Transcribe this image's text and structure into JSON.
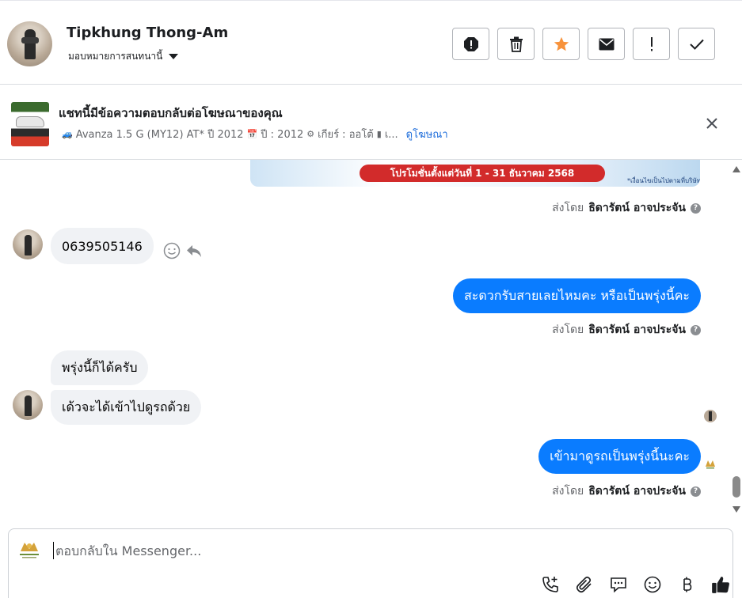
{
  "header": {
    "contact_name": "Tipkhung Thong-Am",
    "assign_label": "มอบหมายการสนทนานี้",
    "actions": [
      {
        "name": "spam-button",
        "icon": "octagon-alert-icon"
      },
      {
        "name": "delete-button",
        "icon": "trash-icon"
      },
      {
        "name": "star-button",
        "icon": "star-icon",
        "color": "#f7923b"
      },
      {
        "name": "mark-unread-button",
        "icon": "envelope-icon"
      },
      {
        "name": "follow-up-button",
        "icon": "exclamation-icon"
      },
      {
        "name": "done-button",
        "icon": "check-icon"
      }
    ]
  },
  "ad": {
    "title": "แชทนี้มีข้อความตอบกลับต่อโฆษณาของคุณ",
    "desc_part1": "Avanza 1.5 G (MY12) AT* ปี 2012",
    "desc_part2": "ปี : 2012",
    "desc_part3": "เกียร์ : ออโต้",
    "desc_part4": "เ...",
    "link": "ดูโฆษณา"
  },
  "messages": {
    "promo_text": "โปรโมชั่นตั้งแต่วันที่ 1 - 31 ธันวาคม 2568",
    "promo_small": "*เงื่อนไขเป็นไปตามที่บริษัทฯ กำหนด",
    "sent_by_prefix": "ส่งโดย",
    "sent_by_name": "ธิดารัตน์ อาจประจัน",
    "msg1": "0639505146",
    "msg2": "สะดวกรับสายเลยไหมคะ หรือเป็นพรุ่งนี้คะ",
    "msg3": "พรุ่งนี้ก็ได้ครับ",
    "msg4": "เด้วจะได้เข้าไปดูรถด้วย",
    "msg5": "เข้ามาดูรถเป็นพรุ่งนี้นะคะ"
  },
  "composer": {
    "placeholder": "ตอบกลับใน Messenger...",
    "tools": [
      "call-add-icon",
      "paperclip-icon",
      "chat-bubble-icon",
      "smile-icon",
      "baht-icon",
      "thumbs-up-icon"
    ]
  },
  "colors": {
    "accent": "#0a7cff",
    "star": "#f7923b",
    "link": "#216fdb",
    "promo_red": "#d22b2b"
  }
}
